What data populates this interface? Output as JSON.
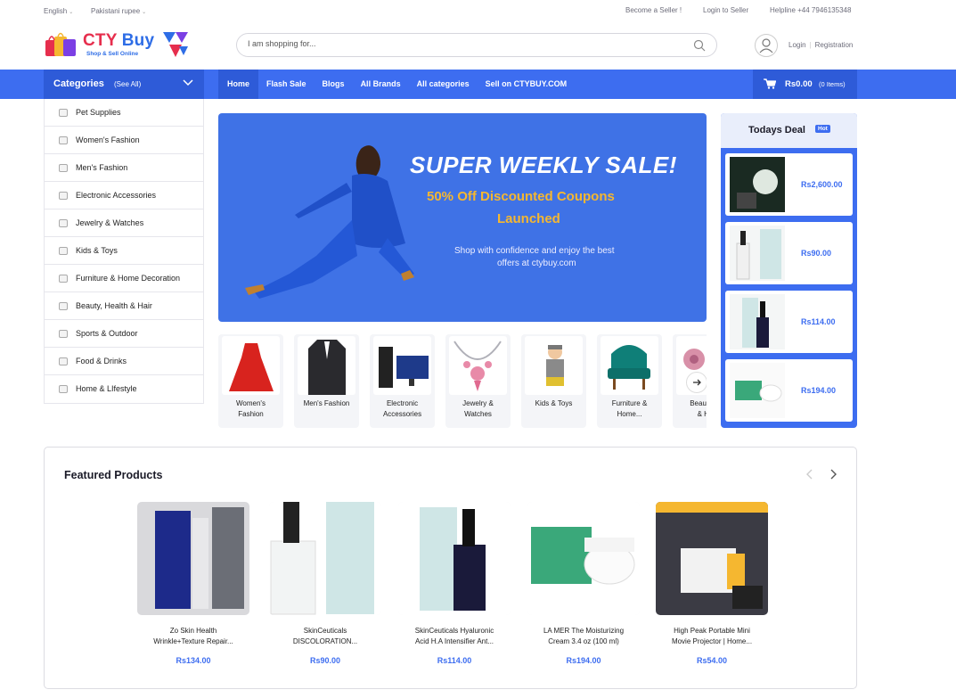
{
  "topbar": {
    "language": "English",
    "currency": "Pakistani rupee",
    "become_seller": "Become a Seller !",
    "login_seller": "Login to Seller",
    "helpline": "Helpline +44 7946135348"
  },
  "brand": {
    "name_part1": "CTY",
    "name_part2": "Buy",
    "tagline": "Shop & Sell Online"
  },
  "search": {
    "placeholder": "I am shopping for..."
  },
  "auth": {
    "login": "Login",
    "register": "Registration"
  },
  "nav": {
    "categories_title": "Categories",
    "see_all": "(See All)",
    "menu": [
      "Home",
      "Flash Sale",
      "Blogs",
      "All Brands",
      "All categories",
      "Sell on CTYBUY.COM"
    ]
  },
  "cart": {
    "amount": "Rs0.00",
    "items": "(0 Items)"
  },
  "categories": [
    "Pet Supplies",
    "Women's Fashion",
    "Men's Fashion",
    "Electronic Accessories",
    "Jewelry & Watches",
    "Kids & Toys",
    "Furniture & Home Decoration",
    "Beauty, Health & Hair",
    "Sports & Outdoor",
    "Food & Drinks",
    "Home & LIfestyle"
  ],
  "banner": {
    "headline": "SUPER WEEKLY SALE!",
    "sub1": "50% Off Discounted Coupons",
    "sub2": "Launched",
    "text1": "Shop with confidence and enjoy the best",
    "text2": "offers at ctybuy.com"
  },
  "category_tiles": [
    {
      "l1": "Women's",
      "l2": "Fashion"
    },
    {
      "l1": "Men's Fashion",
      "l2": ""
    },
    {
      "l1": "Electronic",
      "l2": "Accessories"
    },
    {
      "l1": "Jewelry &",
      "l2": "Watches"
    },
    {
      "l1": "Kids & Toys",
      "l2": ""
    },
    {
      "l1": "Furniture &",
      "l2": "Home..."
    },
    {
      "l1": "Beauty, H",
      "l2": "& Ha"
    }
  ],
  "todays_deal": {
    "title": "Todays Deal",
    "badge": "Hot",
    "items": [
      {
        "price": "Rs2,600.00"
      },
      {
        "price": "Rs90.00"
      },
      {
        "price": "Rs114.00"
      },
      {
        "price": "Rs194.00"
      }
    ]
  },
  "featured": {
    "title": "Featured Products",
    "products": [
      {
        "l1": "Zo Skin Health",
        "l2": "Wrinkle+Texture Repair...",
        "price": "Rs134.00"
      },
      {
        "l1": "SkinCeuticals",
        "l2": "DISCOLORATION...",
        "price": "Rs90.00"
      },
      {
        "l1": "SkinCeuticals Hyaluronic",
        "l2": "Acid H.A Intensifier Ant...",
        "price": "Rs114.00"
      },
      {
        "l1": "LA MER The Moisturizing",
        "l2": "Cream 3.4 oz (100 ml)",
        "price": "Rs194.00"
      },
      {
        "l1": "High Peak Portable Mini",
        "l2": "Movie Projector | Home...",
        "price": "Rs54.00"
      }
    ]
  },
  "colors": {
    "primary": "#3d6df0",
    "primary_dark": "#2e5bd8",
    "accent": "#f5b730",
    "logo_red": "#e62e4d"
  }
}
